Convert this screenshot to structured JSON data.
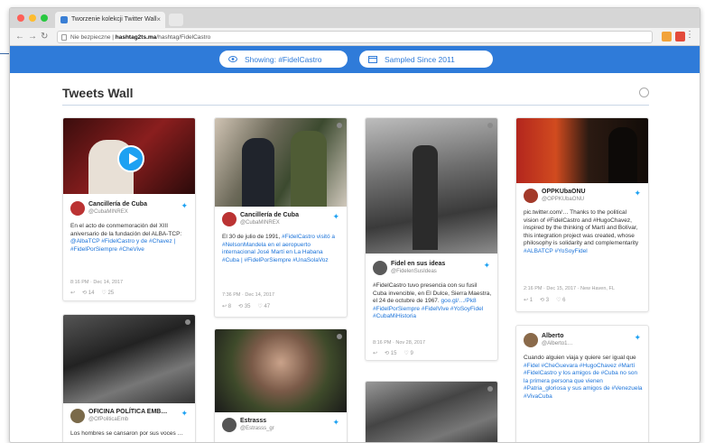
{
  "browser": {
    "tab_title": "Tworzenie kolekcji Twitter Wall",
    "tab_close": "×",
    "nav": {
      "back": "←",
      "forward": "→",
      "reload": "↻"
    },
    "url_prefix": "Nie bezpieczne | ",
    "url_domain": "hashtag2ts.ma",
    "url_path": "/hashtag/FidelCastro",
    "menu": "⋮"
  },
  "banner": {
    "showing_label": "Showing: #FidelCastro",
    "sampled_label": "Sampled Since 2011"
  },
  "wall": {
    "title": "Tweets Wall"
  },
  "cards": [
    {
      "name": "Cancillería de Cuba",
      "handle": "@CubaMINREX",
      "text": "En el acto de conmemoración del XIII aniversario de la fundación del ALBA-TCP: ",
      "links": "@AlbaTCP #FidelCastro y de #Chavez | #FidelPorSiempre #CheVive",
      "date": "8:16 PM · Dec 14, 2017",
      "actions": [
        "↩",
        "⟲ 14",
        "♡ 25"
      ]
    },
    {
      "name": "Cancillería de Cuba",
      "handle": "@CubaMINREX",
      "text": "El 30 de julio de 1991, ",
      "links": "#FidelCastro visitó a #NelsonMandela en el aeropuerto internacional José Martí en La Habana #Cuba | #FidelPorSiempre #UnaSolaVoz",
      "date": "7:36 PM · Dec 14, 2017",
      "actions": [
        "↩ 8",
        "⟲ 35",
        "♡ 47"
      ]
    },
    {
      "name": "Fidel en sus ideas",
      "handle": "@FidelenSusIdeas",
      "text": "#FidelCastro tuvo presencia con su fusil Cuba invencible, en El Dulce, Sierra Maestra, el 24 de octubre de 1967. ",
      "links": "goo.gl/…/Pk8 #FidelPorSiempre #FidelVive #YoSoyFidel #CubaMiHistoria",
      "date": "8:16 PM · Nov 28, 2017",
      "actions": [
        "↩",
        "⟲ 15",
        "♡ 9"
      ]
    },
    {
      "name": "OPPKUbaONU",
      "handle": "@OPPKUbaONU",
      "text": "pic.twitter.com/…  Thanks to the political vision of #FidelCastro and #HugoChavez, inspired by the thinking of Martí and Bolívar, this integration project was created, whose philosophy is solidarity and complementarity ",
      "links": "#ALBATCP #YoSoyFidel",
      "date": "2:16 PM · Dec 15, 2017 · New Haven, FL",
      "actions": [
        "↩ 1",
        "⟲ 3",
        "♡ 6"
      ]
    },
    {
      "name": "OFICINA POLÍTICA EMB…",
      "handle": "@OfPoliticaEmb",
      "text": "Los hombres se cansaron por sus voces …",
      "links": "",
      "date": "",
      "actions": []
    },
    {
      "name": "Estrasss",
      "handle": "@Estrasss_gr",
      "text": "",
      "links": "",
      "date": "",
      "actions": []
    },
    {
      "name": "Alberto",
      "handle": "@Alberto1…",
      "text": "Cuando alguien viaja y quiere ser igual que ",
      "links": "#Fidel #CheGuevara #HugoChavez #Martí #FidelCastro y los amigos de #Cuba no son la primera persona que vienen #Patria_gloriosa y sus amigos de #Venezuela #VivaCuba",
      "date": "",
      "actions": []
    }
  ]
}
